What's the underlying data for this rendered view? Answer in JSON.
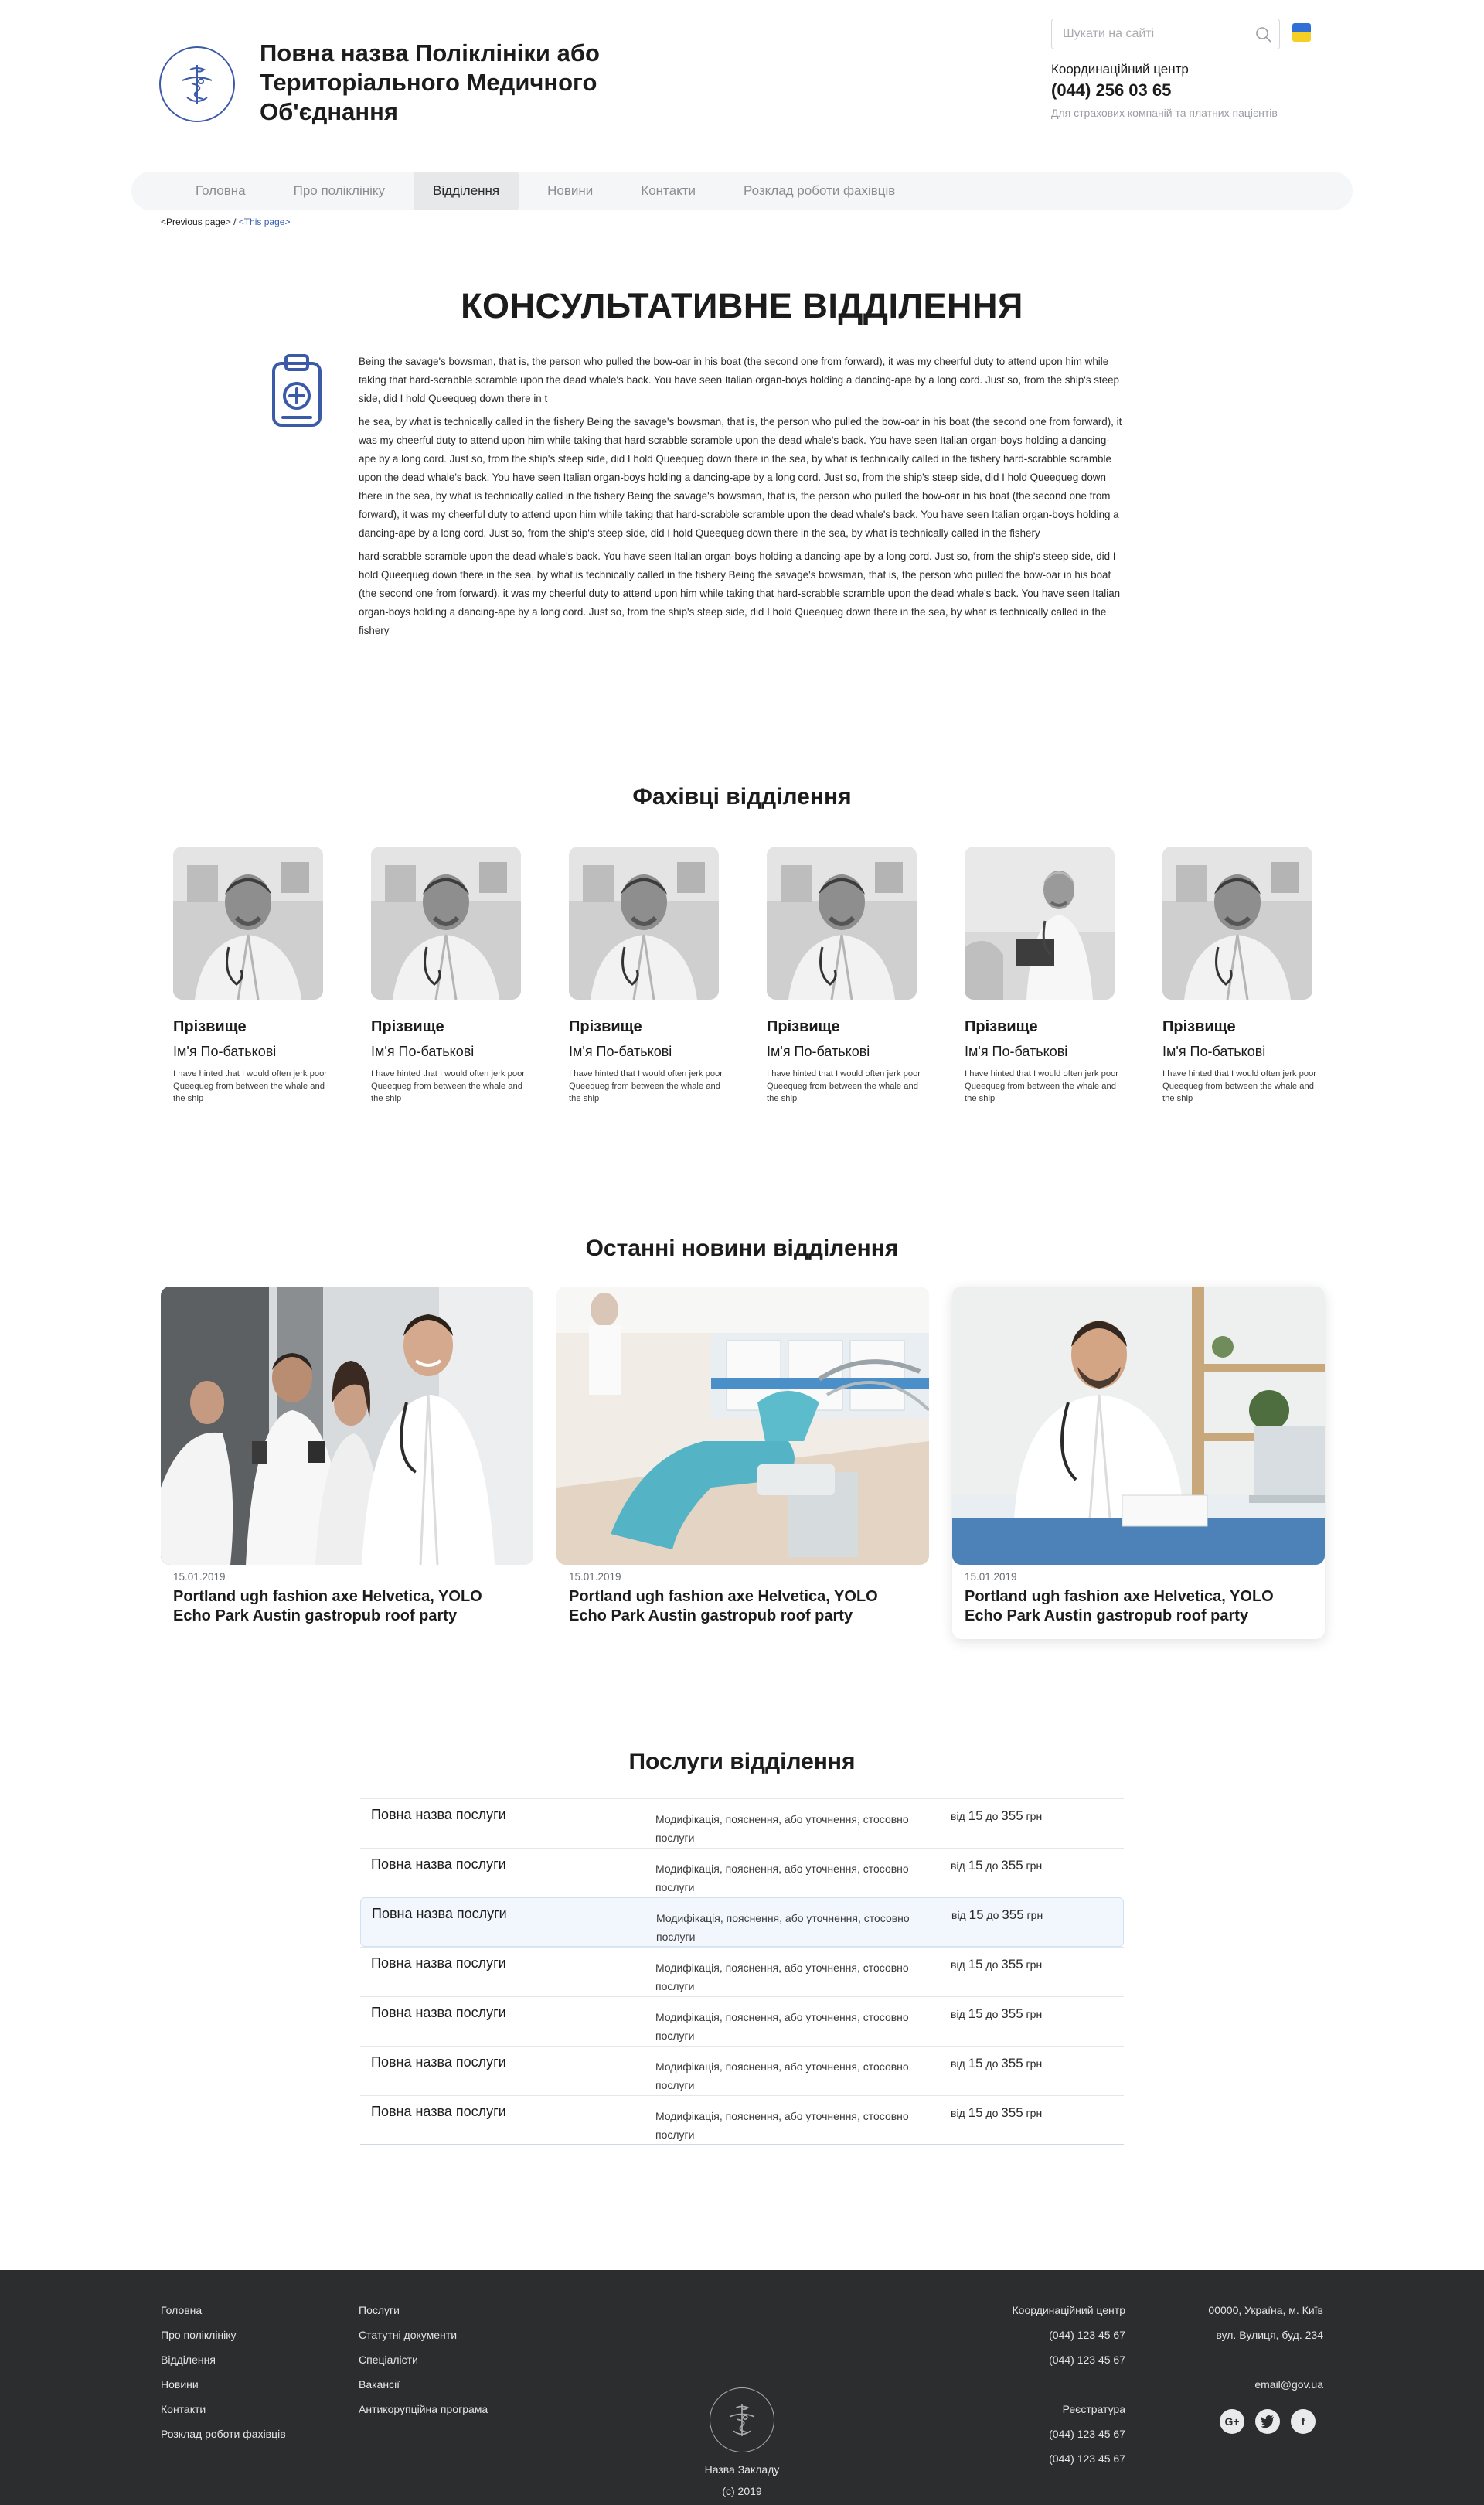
{
  "header": {
    "title": "Повна назва Поліклініки або Територіального Медичного Об'єднання",
    "search_placeholder": "Шукати на сайті",
    "coord_label": "Координаційний центр",
    "coord_phone": "(044) 256 03 65",
    "coord_note": "Для страхових компаній та платних пацієнтів"
  },
  "nav": {
    "items": [
      "Головна",
      "Про поліклініку",
      "Відділення",
      "Новини",
      "Контакти",
      "Розклад роботи фахівців"
    ],
    "active_index": 2
  },
  "breadcrumbs": {
    "prev": "<Previous page>",
    "sep": " / ",
    "current": "<This page>"
  },
  "department": {
    "title": "КОНСУЛЬТАТИВНЕ ВІДДІЛЕННЯ",
    "icon": "clipboard-medical-icon",
    "paragraphs": [
      "Being the savage's bowsman, that is, the person who pulled the bow-oar in his boat (the second one from forward), it was my cheerful duty to attend upon him while taking that hard-scrabble scramble upon the dead whale's back. You have seen Italian organ-boys holding a dancing-ape by a long cord. Just so, from the ship's steep side, did I hold Queequeg down there in t",
      "he sea, by what is technically called in the fishery  Being the savage's bowsman, that is, the person who pulled the bow-oar in his boat (the second one from forward), it was my cheerful duty to attend upon him while taking that hard-scrabble scramble upon the dead whale's back. You have seen Italian organ-boys holding a dancing-ape by a long cord. Just so, from the ship's steep side, did I hold Queequeg down there in the sea, by what is technically called in the fishery hard-scrabble scramble upon the dead whale's back. You have seen Italian organ-boys holding a dancing-ape by a long cord. Just so, from the ship's steep side, did I hold Queequeg down there in the sea, by what is technically called in the fishery  Being the savage's bowsman, that is, the person who pulled the bow-oar in his boat (the second one from forward), it was my cheerful duty to attend upon him while taking that hard-scrabble scramble upon the dead whale's back. You have seen Italian organ-boys holding a dancing-ape by a long cord. Just so, from the ship's steep side, did I hold Queequeg down there in the sea, by what is technically called in the fishery",
      "hard-scrabble scramble upon the dead whale's back. You have seen Italian organ-boys holding a dancing-ape by a long cord. Just so, from the ship's steep side, did I hold Queequeg down there in the sea, by what is technically called in the fishery  Being the savage's bowsman, that is, the person who pulled the bow-oar in his boat (the second one from forward), it was my cheerful duty to attend upon him while taking that hard-scrabble scramble upon the dead whale's back. You have seen Italian organ-boys holding a dancing-ape by a long cord. Just so, from the ship's steep side, did I hold Queequeg down there in the sea, by what is technically called in the fishery"
    ]
  },
  "specialists": {
    "title": "Фахівці відділення",
    "items": [
      {
        "last_name": "Прізвище",
        "first_name": "Ім'я По-батькові",
        "desc": "I have hinted that I would often jerk poor Queequeg from between the whale and the ship"
      },
      {
        "last_name": "Прізвище",
        "first_name": "Ім'я По-батькові",
        "desc": "I have hinted that I would often jerk poor Queequeg from between the whale and the ship"
      },
      {
        "last_name": "Прізвище",
        "first_name": "Ім'я По-батькові",
        "desc": "I have hinted that I would often jerk poor Queequeg from between the whale and the ship"
      },
      {
        "last_name": "Прізвище",
        "first_name": "Ім'я По-батькові",
        "desc": "I have hinted that I would often jerk poor Queequeg from between the whale and the ship"
      },
      {
        "last_name": "Прізвище",
        "first_name": "Ім'я По-батькові",
        "desc": "I have hinted that I would often jerk poor Queequeg from between the whale and the ship"
      },
      {
        "last_name": "Прізвище",
        "first_name": "Ім'я По-батькові",
        "desc": "I have hinted that I would often jerk poor Queequeg from between the whale and the ship"
      }
    ]
  },
  "news": {
    "title": "Останні новини відділення",
    "items": [
      {
        "date": "15.01.2019",
        "title": "Portland ugh fashion axe Helvetica, YOLO Echo Park Austin gastropub roof party",
        "image": "doctors-group-photo"
      },
      {
        "date": "15.01.2019",
        "title": "Portland ugh fashion axe Helvetica, YOLO Echo Park Austin gastropub roof party",
        "image": "dental-chair-photo"
      },
      {
        "date": "15.01.2019",
        "title": "Portland ugh fashion axe Helvetica, YOLO Echo Park Austin gastropub roof party",
        "image": "doctor-at-desk-photo"
      }
    ]
  },
  "services": {
    "title": "Послуги відділення",
    "highlight_index": 2,
    "items": [
      {
        "name": "Повна назва послуги",
        "desc": "Модифікація, пояснення, або уточнення, стосовно послуги",
        "from_label": "від",
        "from": "15",
        "to_label": "до",
        "to": "355",
        "currency": "грн"
      },
      {
        "name": "Повна назва послуги",
        "desc": "Модифікація, пояснення, або уточнення, стосовно послуги",
        "from_label": "від",
        "from": "15",
        "to_label": "до",
        "to": "355",
        "currency": "грн"
      },
      {
        "name": "Повна назва послуги",
        "desc": "Модифікація, пояснення, або уточнення, стосовно послуги",
        "from_label": "від",
        "from": "15",
        "to_label": "до",
        "to": "355",
        "currency": "грн"
      },
      {
        "name": "Повна назва послуги",
        "desc": "Модифікація, пояснення, або уточнення, стосовно послуги",
        "from_label": "від",
        "from": "15",
        "to_label": "до",
        "to": "355",
        "currency": "грн"
      },
      {
        "name": "Повна назва послуги",
        "desc": "Модифікація, пояснення, або уточнення, стосовно послуги",
        "from_label": "від",
        "from": "15",
        "to_label": "до",
        "to": "355",
        "currency": "грн"
      },
      {
        "name": "Повна назва послуги",
        "desc": "Модифікація, пояснення, або уточнення, стосовно послуги",
        "from_label": "від",
        "from": "15",
        "to_label": "до",
        "to": "355",
        "currency": "грн"
      },
      {
        "name": "Повна назва послуги",
        "desc": "Модифікація, пояснення, або уточнення, стосовно послуги",
        "from_label": "від",
        "from": "15",
        "to_label": "до",
        "to": "355",
        "currency": "грн"
      }
    ]
  },
  "footer": {
    "col1": [
      "Головна",
      "Про поліклініку",
      "Відділення",
      "Новини",
      "Контакти",
      "Розклад роботи фахівців"
    ],
    "col2": [
      "Послуги",
      "Статутні документи",
      "Спеціалісти",
      "Вакансії",
      "Антикорупційна програма"
    ],
    "coord_label": "Координаційний центр",
    "coord_phones": [
      "(044) 123 45 67",
      "(044) 123 45 67"
    ],
    "reg_label": "Реєстратура",
    "reg_phones": [
      "(044) 123 45 67",
      "(044) 123 45 67"
    ],
    "address1": "00000, Україна, м. Київ",
    "address2": "вул. Вулиця, буд. 234",
    "email": "email@gov.ua",
    "socials": [
      "google-plus-icon",
      "twitter-icon",
      "facebook-icon"
    ],
    "institution": "Назва Закладу",
    "copyright": "(с) 2019"
  },
  "colors": {
    "accent": "#3b5ba9",
    "link": "#3a5fb3",
    "footer_bg": "#2c2d2f",
    "nav_bg": "#f5f6f7",
    "highlight_row": "#f1f7fc"
  }
}
